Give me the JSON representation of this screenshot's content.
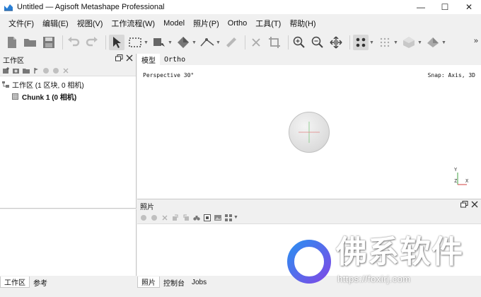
{
  "window": {
    "title": "Untitled — Agisoft Metashape Professional",
    "min": "—",
    "max": "☐",
    "close": "✕"
  },
  "menu": [
    "文件(F)",
    "编辑(E)",
    "视图(V)",
    "工作流程(W)",
    "Model",
    "照片(P)",
    "Ortho",
    "工具(T)",
    "帮助(H)"
  ],
  "workspace": {
    "title": "工作区",
    "tree_root": "工作区 (1 区块, 0 相机)",
    "chunk": "Chunk 1 (0 相机)",
    "tabs": [
      "工作区",
      "参考"
    ]
  },
  "view": {
    "tabs": [
      "模型",
      "Ortho"
    ],
    "perspective": "Perspective 30°",
    "snap": "Snap: Axis, 3D",
    "axis_y": "Y",
    "axis_z": "Z",
    "axis_x": "X"
  },
  "photos": {
    "title": "照片",
    "tabs": [
      "照片",
      "控制台",
      "Jobs"
    ]
  },
  "toolbar_more": "»",
  "watermark": {
    "text": "佛系软件",
    "url": "https://foxirj.com"
  },
  "colors": {
    "accent_blue": "#1f6fd0",
    "sphere": "#dcdcdc"
  }
}
